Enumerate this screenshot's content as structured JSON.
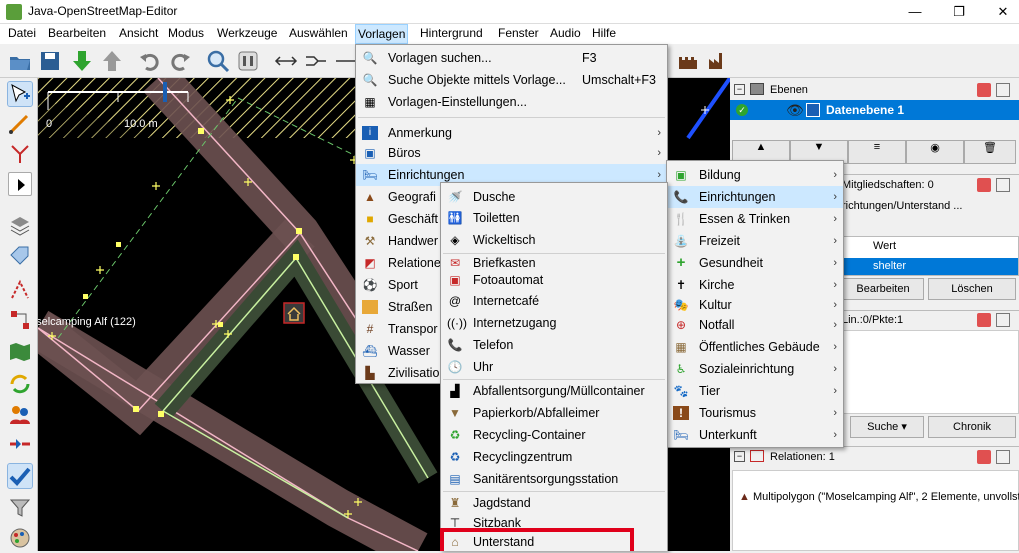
{
  "window": {
    "title": "Java-OpenStreetMap-Editor",
    "minimize": "—",
    "restore": "❐",
    "close": "✕"
  },
  "menubar": [
    "Datei",
    "Bearbeiten",
    "Ansicht",
    "Modus",
    "Werkzeuge",
    "Auswählen",
    "Vorlagen",
    "Hintergrund",
    "Fenster",
    "Audio",
    "Hilfe"
  ],
  "map": {
    "scale_left": "0",
    "scale_right": "10.0 m",
    "feature_label": "oselcamping Alf (122)"
  },
  "vorlagen_menu": {
    "items": [
      {
        "label": "Vorlagen suchen...",
        "shortcut": "F3",
        "icon": "search-icon"
      },
      {
        "label": "Suche Objekte mittels Vorlage...",
        "shortcut": "Umschalt+F3",
        "icon": "search-object-icon"
      },
      {
        "label": "Vorlagen-Einstellungen...",
        "icon": "preset-settings-icon"
      },
      {
        "label": "Anmerkung",
        "icon": "annotation-icon"
      },
      {
        "label": "Büros",
        "icon": "office-icon"
      },
      {
        "label": "Einrichtungen",
        "icon": "bed-icon"
      },
      {
        "label": "Geografi",
        "icon": "mountain-icon"
      },
      {
        "label": "Geschäft",
        "icon": "shop-icon"
      },
      {
        "label": "Handwer",
        "icon": "craft-icon"
      },
      {
        "label": "Relatione",
        "icon": "relation-icon"
      },
      {
        "label": "Sport",
        "icon": "ball-icon"
      },
      {
        "label": "Straßen",
        "icon": "road-icon"
      },
      {
        "label": "Transpor",
        "icon": "railway-icon"
      },
      {
        "label": "Wasser",
        "icon": "water-icon"
      },
      {
        "label": "Zivilisatio",
        "icon": "factory-icon"
      }
    ]
  },
  "einrichtungen_submenu": {
    "items": [
      {
        "label": "Bildung",
        "icon": "education-icon"
      },
      {
        "label": "Einrichtungen",
        "icon": "phone-icon"
      },
      {
        "label": "Essen & Trinken",
        "icon": "fork-knife-icon"
      },
      {
        "label": "Freizeit",
        "icon": "leisure-icon"
      },
      {
        "label": "Gesundheit",
        "icon": "cross-icon"
      },
      {
        "label": "Kirche",
        "icon": "church-icon"
      },
      {
        "label": "Kultur",
        "icon": "theatre-icon"
      },
      {
        "label": "Notfall",
        "icon": "emergency-icon"
      },
      {
        "label": "Öffentliches Gebäude",
        "icon": "building-icon"
      },
      {
        "label": "Sozialeinrichtung",
        "icon": "social-icon"
      },
      {
        "label": "Tier",
        "icon": "animal-icon"
      },
      {
        "label": "Tourismus",
        "icon": "info-icon"
      },
      {
        "label": "Unterkunft",
        "icon": "accommodation-icon"
      }
    ]
  },
  "einrichtungen_items": {
    "items": [
      {
        "label": "Dusche",
        "icon": "shower-icon"
      },
      {
        "label": "Toiletten",
        "icon": "toilets-icon"
      },
      {
        "label": "Wickeltisch",
        "icon": "changing-table-icon"
      },
      {
        "label": "Briefkasten",
        "icon": "mailbox-icon"
      },
      {
        "label": "Fotoautomat",
        "icon": "photo-booth-icon"
      },
      {
        "label": "Internetcafé",
        "icon": "at-icon"
      },
      {
        "label": "Internetzugang",
        "icon": "wifi-icon"
      },
      {
        "label": "Telefon",
        "icon": "phone-icon"
      },
      {
        "label": "Uhr",
        "icon": "clock-icon"
      },
      {
        "label": "Abfallentsorgung/Müllcontainer",
        "icon": "waste-container-icon"
      },
      {
        "label": "Papierkorb/Abfalleimer",
        "icon": "waste-basket-icon"
      },
      {
        "label": "Recycling-Container",
        "icon": "recycling-icon"
      },
      {
        "label": "Recyclingzentrum",
        "icon": "recycling-center-icon"
      },
      {
        "label": "Sanitärentsorgungsstation",
        "icon": "sanitary-dump-icon"
      },
      {
        "label": "Jagdstand",
        "icon": "hunting-stand-icon"
      },
      {
        "label": "Sitzbank",
        "icon": "bench-icon"
      },
      {
        "label": "Unterstand",
        "icon": "shelter-icon"
      }
    ]
  },
  "right_panel": {
    "layers_title": "Ebenen",
    "layer_name": "Datenebene 1",
    "memberships": "Mitgliedschaften: 0",
    "preset_line": "richtungen/Unterstand ...",
    "col_value": "Wert",
    "tag_value": "shelter",
    "edit_btn": "Bearbeiten",
    "delete_btn": "Löschen",
    "info_line": "Lin.:0/Pkte:1",
    "search_btn": "Suche",
    "history_btn": "Chronik",
    "relations_title": "Relationen: 1",
    "relation_entry": "Multipolygon (\"Moselcamping Alf\", 2 Elemente, unvollst"
  },
  "colors": {
    "highlight": "#cce8ff",
    "selection_blue": "#0078d7",
    "red_box": "#e0001b"
  }
}
